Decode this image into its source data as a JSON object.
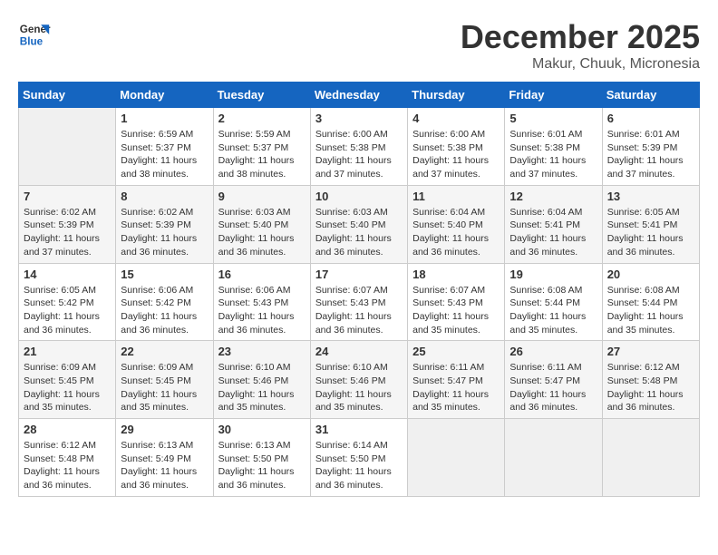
{
  "header": {
    "logo_line1": "General",
    "logo_line2": "Blue",
    "month": "December 2025",
    "location": "Makur, Chuuk, Micronesia"
  },
  "days_of_week": [
    "Sunday",
    "Monday",
    "Tuesday",
    "Wednesday",
    "Thursday",
    "Friday",
    "Saturday"
  ],
  "weeks": [
    [
      {
        "day": "",
        "empty": true
      },
      {
        "day": "1",
        "sunrise": "6:59 AM",
        "sunset": "5:37 PM",
        "daylight": "11 hours and 38 minutes."
      },
      {
        "day": "2",
        "sunrise": "5:59 AM",
        "sunset": "5:37 PM",
        "daylight": "11 hours and 38 minutes."
      },
      {
        "day": "3",
        "sunrise": "6:00 AM",
        "sunset": "5:38 PM",
        "daylight": "11 hours and 37 minutes."
      },
      {
        "day": "4",
        "sunrise": "6:00 AM",
        "sunset": "5:38 PM",
        "daylight": "11 hours and 37 minutes."
      },
      {
        "day": "5",
        "sunrise": "6:01 AM",
        "sunset": "5:38 PM",
        "daylight": "11 hours and 37 minutes."
      },
      {
        "day": "6",
        "sunrise": "6:01 AM",
        "sunset": "5:39 PM",
        "daylight": "11 hours and 37 minutes."
      }
    ],
    [
      {
        "day": "7",
        "sunrise": "6:02 AM",
        "sunset": "5:39 PM",
        "daylight": "11 hours and 37 minutes."
      },
      {
        "day": "8",
        "sunrise": "6:02 AM",
        "sunset": "5:39 PM",
        "daylight": "11 hours and 36 minutes."
      },
      {
        "day": "9",
        "sunrise": "6:03 AM",
        "sunset": "5:40 PM",
        "daylight": "11 hours and 36 minutes."
      },
      {
        "day": "10",
        "sunrise": "6:03 AM",
        "sunset": "5:40 PM",
        "daylight": "11 hours and 36 minutes."
      },
      {
        "day": "11",
        "sunrise": "6:04 AM",
        "sunset": "5:40 PM",
        "daylight": "11 hours and 36 minutes."
      },
      {
        "day": "12",
        "sunrise": "6:04 AM",
        "sunset": "5:41 PM",
        "daylight": "11 hours and 36 minutes."
      },
      {
        "day": "13",
        "sunrise": "6:05 AM",
        "sunset": "5:41 PM",
        "daylight": "11 hours and 36 minutes."
      }
    ],
    [
      {
        "day": "14",
        "sunrise": "6:05 AM",
        "sunset": "5:42 PM",
        "daylight": "11 hours and 36 minutes."
      },
      {
        "day": "15",
        "sunrise": "6:06 AM",
        "sunset": "5:42 PM",
        "daylight": "11 hours and 36 minutes."
      },
      {
        "day": "16",
        "sunrise": "6:06 AM",
        "sunset": "5:43 PM",
        "daylight": "11 hours and 36 minutes."
      },
      {
        "day": "17",
        "sunrise": "6:07 AM",
        "sunset": "5:43 PM",
        "daylight": "11 hours and 36 minutes."
      },
      {
        "day": "18",
        "sunrise": "6:07 AM",
        "sunset": "5:43 PM",
        "daylight": "11 hours and 35 minutes."
      },
      {
        "day": "19",
        "sunrise": "6:08 AM",
        "sunset": "5:44 PM",
        "daylight": "11 hours and 35 minutes."
      },
      {
        "day": "20",
        "sunrise": "6:08 AM",
        "sunset": "5:44 PM",
        "daylight": "11 hours and 35 minutes."
      }
    ],
    [
      {
        "day": "21",
        "sunrise": "6:09 AM",
        "sunset": "5:45 PM",
        "daylight": "11 hours and 35 minutes."
      },
      {
        "day": "22",
        "sunrise": "6:09 AM",
        "sunset": "5:45 PM",
        "daylight": "11 hours and 35 minutes."
      },
      {
        "day": "23",
        "sunrise": "6:10 AM",
        "sunset": "5:46 PM",
        "daylight": "11 hours and 35 minutes."
      },
      {
        "day": "24",
        "sunrise": "6:10 AM",
        "sunset": "5:46 PM",
        "daylight": "11 hours and 35 minutes."
      },
      {
        "day": "25",
        "sunrise": "6:11 AM",
        "sunset": "5:47 PM",
        "daylight": "11 hours and 35 minutes."
      },
      {
        "day": "26",
        "sunrise": "6:11 AM",
        "sunset": "5:47 PM",
        "daylight": "11 hours and 36 minutes."
      },
      {
        "day": "27",
        "sunrise": "6:12 AM",
        "sunset": "5:48 PM",
        "daylight": "11 hours and 36 minutes."
      }
    ],
    [
      {
        "day": "28",
        "sunrise": "6:12 AM",
        "sunset": "5:48 PM",
        "daylight": "11 hours and 36 minutes."
      },
      {
        "day": "29",
        "sunrise": "6:13 AM",
        "sunset": "5:49 PM",
        "daylight": "11 hours and 36 minutes."
      },
      {
        "day": "30",
        "sunrise": "6:13 AM",
        "sunset": "5:50 PM",
        "daylight": "11 hours and 36 minutes."
      },
      {
        "day": "31",
        "sunrise": "6:14 AM",
        "sunset": "5:50 PM",
        "daylight": "11 hours and 36 minutes."
      },
      {
        "day": "",
        "empty": true
      },
      {
        "day": "",
        "empty": true
      },
      {
        "day": "",
        "empty": true
      }
    ]
  ],
  "labels": {
    "sunrise_prefix": "Sunrise: ",
    "sunset_prefix": "Sunset: ",
    "daylight_prefix": "Daylight: "
  }
}
